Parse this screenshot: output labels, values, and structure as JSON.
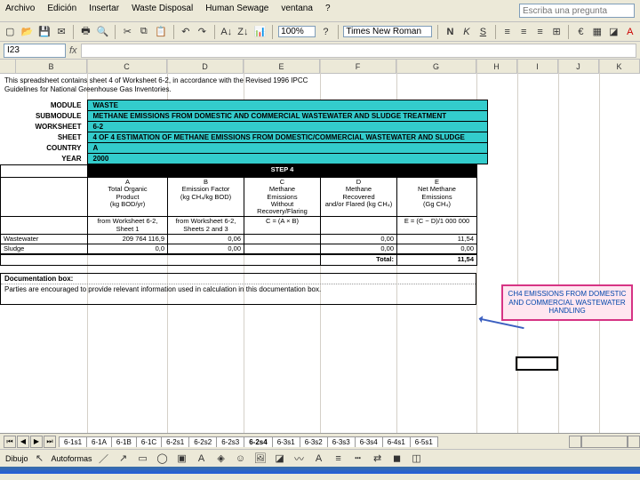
{
  "menu": [
    "Archivo",
    "Edición",
    "Insertar",
    "Waste Disposal",
    "Human Sewage",
    "ventana",
    "?"
  ],
  "search_placeholder": "Escriba una pregunta",
  "namebox": "I23",
  "zoom": "100%",
  "font": "Times New Roman",
  "colheads": [
    "",
    "B",
    "C",
    "D",
    "E",
    "F",
    "G",
    "H",
    "I",
    "J",
    "K"
  ],
  "note": "This spreadsheet contains sheet 4 of Worksheet 6-2, in accordance with the Revised 1996 IPCC Guidelines for National Greenhouse Gas Inventories.",
  "hdr": {
    "module_l": "MODULE",
    "module_v": "WASTE",
    "sub_l": "SUBMODULE",
    "sub_v": "METHANE EMISSIONS FROM DOMESTIC AND COMMERCIAL WASTEWATER AND SLUDGE TREATMENT",
    "ws_l": "WORKSHEET",
    "ws_v": "6-2",
    "sh_l": "SHEET",
    "sh_v": "4 OF 4   ESTIMATION OF METHANE EMISSIONS FROM DOMESTIC/COMMERCIAL WASTEWATER AND SLUDGE",
    "co_l": "COUNTRY",
    "co_v": "A",
    "yr_l": "YEAR",
    "yr_v": "2000"
  },
  "step": "STEP 4",
  "cols": {
    "A": {
      "h": "A",
      "t1": "Total Organic",
      "t2": "Product",
      "t3": "(kg BOD/yr)",
      "src": "from Worksheet 6-2, Sheet 1"
    },
    "B": {
      "h": "B",
      "t1": "Emission Factor",
      "t2": "(kg CH₄/kg BOD)",
      "t3": "",
      "src": "from Worksheet 6-2, Sheets 2 and 3"
    },
    "C": {
      "h": "C",
      "t1": "Methane",
      "t2": "Emissions",
      "t3": "Without Recovery/Flaring",
      "src": "C = (A × B)"
    },
    "D": {
      "h": "D",
      "t1": "Methane",
      "t2": "Recovered",
      "t3": "and/or Flared (kg CH₄)",
      "src": ""
    },
    "E": {
      "h": "E",
      "t1": "Net Methane",
      "t2": "Emissions",
      "t3": "(Gg CH₄)",
      "src": "E = (C − D)/1 000 000"
    }
  },
  "rows": [
    {
      "name": "Wastewater",
      "A": "209 764 116,9",
      "B": "0,06",
      "C": "",
      "D": "0,00",
      "E": "11,54"
    },
    {
      "name": "Sludge",
      "A": "0,0",
      "B": "0,00",
      "C": "",
      "D": "0,00",
      "E": "0,00"
    }
  ],
  "total_l": "Total:",
  "total_v": "11,54",
  "callout": "CH4 EMISSIONS FROM DOMESTIC AND COMMERCIAL WASTEWATER HANDLING",
  "doc_h": "Documentation box:",
  "doc_t": "Parties are encouraged to provide relevant information used in calculation in this documentation box.",
  "tabs": [
    "6-1s1",
    "6-1A",
    "6-1B",
    "6-1C",
    "6-2s1",
    "6-2s2",
    "6-2s3",
    "6-2s4",
    "6-3s1",
    "6-3s2",
    "6-3s3",
    "6-3s4",
    "6-4s1",
    "6-5s1"
  ],
  "active_tab": "6-2s4",
  "draw_label": "Dibujo",
  "autoform": "Autoformas"
}
